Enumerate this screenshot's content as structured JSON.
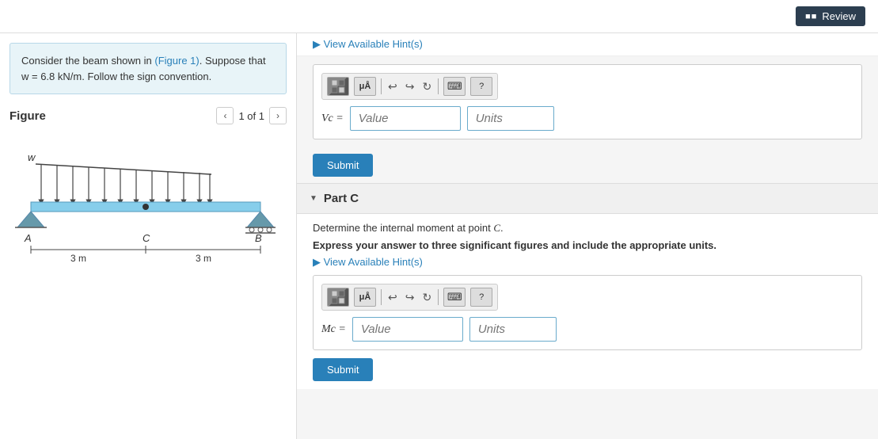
{
  "topbar": {
    "review_label": "Review",
    "review_icon": "■■"
  },
  "left_panel": {
    "problem": {
      "text_before": "Consider the beam shown in ",
      "link_text": "(Figure 1)",
      "text_after": ". Suppose that",
      "line2": "w = 6.8 kN/m. Follow the sign convention."
    },
    "figure": {
      "title": "Figure",
      "nav_prev": "‹",
      "nav_page": "1 of 1",
      "nav_next": "›"
    }
  },
  "right_panel": {
    "hint_top_label": "▶  View Available Hint(s)",
    "toolbar_part_b": {
      "matrix_icon": "▦",
      "mu_a_label": "μÅ",
      "undo_icon": "↩",
      "redo_icon": "↪",
      "refresh_icon": "↻",
      "keyboard_icon": "⌨",
      "help_icon": "?"
    },
    "part_b": {
      "eq_label": "Vc =",
      "value_placeholder": "Value",
      "units_placeholder": "Units",
      "submit_label": "Submit"
    },
    "part_c_header": {
      "expand_icon": "▼",
      "label": "Part C"
    },
    "part_c": {
      "description": "Determine the internal moment at point ",
      "point": "C",
      "instruction": "Express your answer to three significant figures and include the appropriate units.",
      "hint_label": "▶ View Available Hint(s)",
      "eq_label": "Mc =",
      "value_placeholder": "Value",
      "units_placeholder": "Units",
      "submit_label": "Submit"
    },
    "toolbar_part_c": {
      "matrix_icon": "▦",
      "mu_a_label": "μÅ",
      "undo_icon": "↩",
      "redo_icon": "↪",
      "refresh_icon": "↻",
      "keyboard_icon": "⌨",
      "help_icon": "?"
    }
  },
  "colors": {
    "accent_blue": "#2980b9",
    "light_blue_bg": "#e8f4f8",
    "toolbar_bg": "#f0f0f0",
    "submit_bg": "#2980b9",
    "border_blue": "#6aabcc"
  }
}
